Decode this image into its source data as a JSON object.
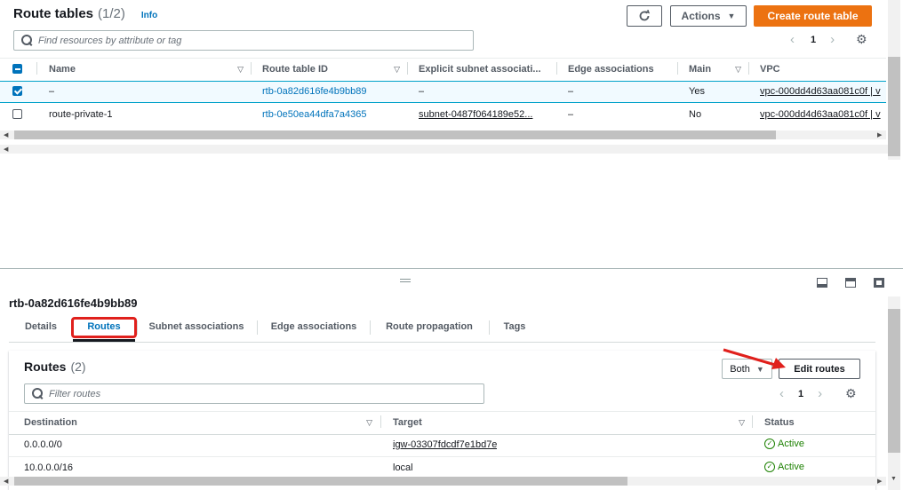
{
  "top": {
    "title": "Route tables",
    "count": "(1/2)",
    "info": "Info",
    "refresh_icon": "refresh-icon",
    "actions_label": "Actions",
    "create_label": "Create route table",
    "search_placeholder": "Find resources by attribute or tag",
    "page": "1",
    "columns": [
      "Name",
      "Route table ID",
      "Explicit subnet associati...",
      "Edge associations",
      "Main",
      "VPC"
    ],
    "rows": [
      {
        "selected": true,
        "name": "–",
        "id": "rtb-0a82d616fe4b9bb89",
        "subnet": "–",
        "edge": "–",
        "main": "Yes",
        "vpc": "vpc-000dd4d63aa081c0f | v"
      },
      {
        "selected": false,
        "name": "route-private-1",
        "id": "rtb-0e50ea44dfa7a4365",
        "subnet": "subnet-0487f064189e52...",
        "edge": "–",
        "main": "No",
        "vpc": "vpc-000dd4d63aa081c0f | v"
      }
    ]
  },
  "detail": {
    "title": "rtb-0a82d616fe4b9bb89",
    "tabs": [
      "Details",
      "Routes",
      "Subnet associations",
      "Edge associations",
      "Route propagation",
      "Tags"
    ],
    "active_tab": "Routes",
    "routes": {
      "title": "Routes",
      "count": "(2)",
      "filter_value": "Both",
      "edit_label": "Edit routes",
      "search_placeholder": "Filter routes",
      "page": "1",
      "columns": [
        "Destination",
        "Target",
        "Status"
      ],
      "rows": [
        {
          "destination": "0.0.0.0/0",
          "target": "igw-03307fdcdf7e1bd7e",
          "target_link": true,
          "status": "Active"
        },
        {
          "destination": "10.0.0.0/16",
          "target": "local",
          "target_link": false,
          "status": "Active"
        }
      ]
    }
  },
  "colors": {
    "primary": "#ec7211",
    "link": "#0073bb",
    "annotation": "#e0201c",
    "active": "#1d8102"
  }
}
